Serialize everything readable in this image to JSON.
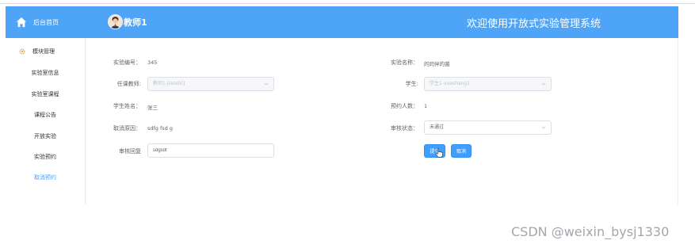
{
  "sidebar": {
    "home_label": "后台首页",
    "menu_title": "模块管理",
    "items": [
      {
        "label": "实验室信息"
      },
      {
        "label": "实验室课程"
      },
      {
        "label": "课程公告"
      },
      {
        "label": "开放实验"
      },
      {
        "label": "实验预约"
      },
      {
        "label": "取消预约"
      }
    ],
    "active_index": 5
  },
  "header": {
    "user_name": "教师1",
    "system_title": "欢迎使用开放式实验管理系统"
  },
  "form": {
    "exp_no_label": "实验编号：",
    "exp_no_value": "345",
    "exp_name_label": "实验名称：",
    "exp_name_value": "的同伴的菌",
    "teacher_label": "任课教师:",
    "teacher_value": "教师1-jiaoshi1",
    "student_label": "学生:",
    "student_value": "学生1-xueshang1",
    "student_name_label": "学生姓名：",
    "student_name_value": "张三",
    "booking_count_label": "预约人数：",
    "booking_count_value": "1",
    "cancel_reason_label": "取消原因：",
    "cancel_reason_value": "sdfg fsd g",
    "review_status_label": "审核状态：",
    "review_status_value": "未通过",
    "review_reply_label": "审核回复",
    "review_reply_value": "sdgsdf"
  },
  "buttons": {
    "submit_label": "提交",
    "cancel_label": "取消"
  },
  "watermark": "CSDN @weixin_bysj1330",
  "colors": {
    "header_bg": "#4ea4f7",
    "accent": "#409eff"
  },
  "icons": [
    "home-icon",
    "avatar-icon",
    "gear-icon",
    "chevron-down-icon",
    "hand-cursor-icon"
  ]
}
